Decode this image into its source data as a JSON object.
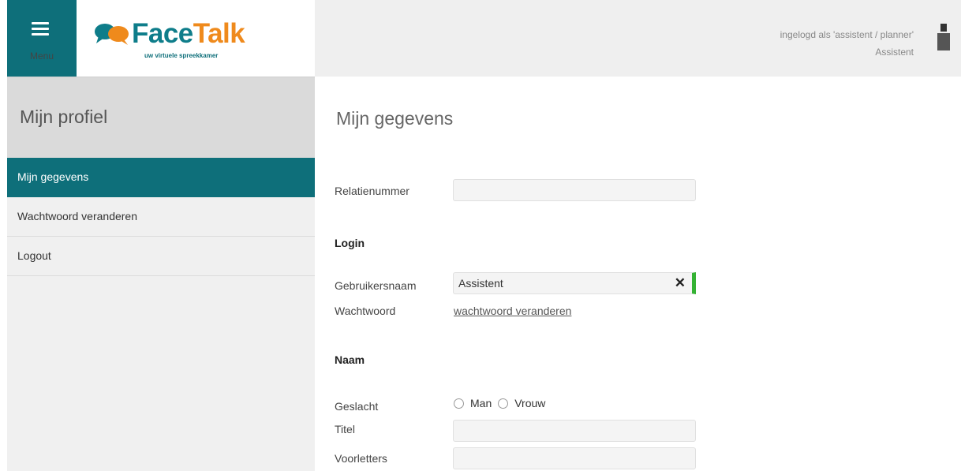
{
  "header": {
    "menu_label": "Menu",
    "logo_face": "Face",
    "logo_talk": "Talk",
    "logo_tagline": "uw virtuele spreekkamer",
    "logged_in_text": "ingelogd als 'assistent / planner'",
    "user_role": "Assistent"
  },
  "sidebar": {
    "title": "Mijn profiel",
    "items": [
      {
        "label": "Mijn gegevens",
        "active": true
      },
      {
        "label": "Wachtwoord veranderen"
      },
      {
        "label": "Logout"
      }
    ]
  },
  "main": {
    "title": "Mijn gegevens",
    "fields": {
      "relatienummer": {
        "label": "Relatienummer",
        "value": ""
      },
      "login_section": "Login",
      "gebruikersnaam": {
        "label": "Gebruikersnaam",
        "value": "Assistent"
      },
      "wachtwoord": {
        "label": "Wachtwoord",
        "link": "wachtwoord veranderen"
      },
      "naam_section": "Naam",
      "geslacht": {
        "label": "Geslacht",
        "options": [
          "Man",
          "Vrouw"
        ]
      },
      "titel": {
        "label": "Titel",
        "value": ""
      },
      "voorletters": {
        "label": "Voorletters",
        "value": ""
      }
    }
  },
  "colors": {
    "accent": "#0e6f7a",
    "brand_orange": "#ef8a1c",
    "valid": "#34b233"
  },
  "icons": [
    "hamburger-icon",
    "chat-bubble-logo-icon",
    "user-icon",
    "close-icon"
  ]
}
